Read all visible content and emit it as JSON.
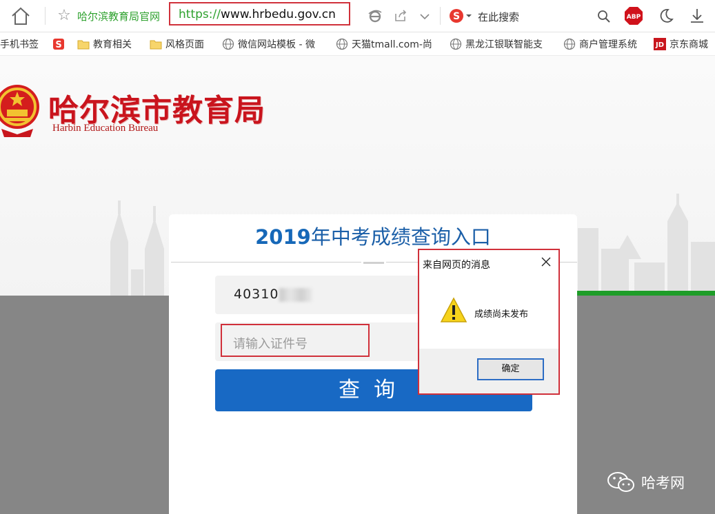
{
  "browser": {
    "tab_title": "哈尔滨教育局官网",
    "url_protocol": "https://",
    "url_host": "www.hrbedu.gov.cn",
    "search_placeholder": "在此搜索"
  },
  "bookmarks": [
    {
      "label": "手机书签",
      "icon": "none"
    },
    {
      "label": "",
      "icon": "sogou-icon"
    },
    {
      "label": "教育相关",
      "icon": "folder-icon"
    },
    {
      "label": "风格页面",
      "icon": "folder-icon"
    },
    {
      "label": "微信网站模板 - 微",
      "icon": "globe-icon"
    },
    {
      "label": "天猫tmall.com-尚",
      "icon": "globe-icon"
    },
    {
      "label": "黑龙江银联智能支",
      "icon": "globe-icon"
    },
    {
      "label": "商户管理系统",
      "icon": "globe-icon"
    },
    {
      "label": "京东商城",
      "icon": "jd-icon"
    }
  ],
  "header": {
    "logo_cn": "哈尔滨市教育局",
    "logo_en": "Harbin Education  Bureau"
  },
  "card": {
    "title_year": "2019",
    "title_rest": "年中考成绩查询入口",
    "id_value": "40310",
    "cert_placeholder": "请输入证件号",
    "query_label": "查询"
  },
  "dialog": {
    "title": "来自网页的消息",
    "message": "成绩尚未发布",
    "ok_label": "确定"
  },
  "watermark": {
    "text": "哈考网"
  },
  "colors": {
    "brand_red": "#c9141d",
    "title_blue": "#1a6bb8",
    "button_blue": "#1869c4",
    "highlight_red": "#d0303a",
    "green_accent": "#1e9d28"
  }
}
